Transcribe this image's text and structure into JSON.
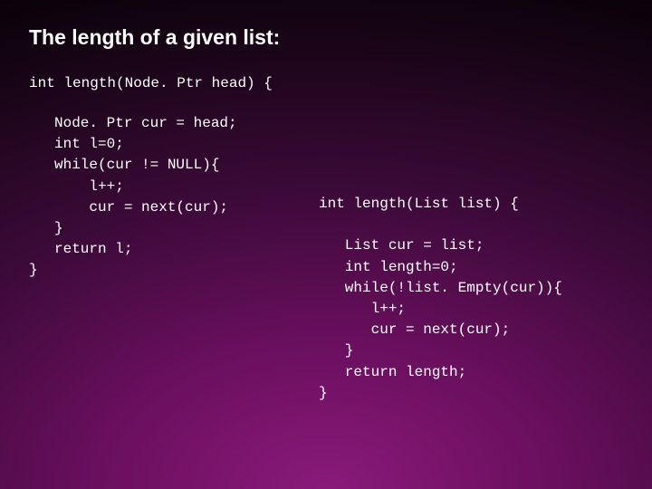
{
  "title": "The length of a given list:",
  "signature": "int length(Node. Ptr head) {",
  "code_left": "Node. Ptr cur = head;\nint l=0;\nwhile(cur != NULL){\n    l++;\n    cur = next(cur);\n}\nreturn l;",
  "code_left_close": "}",
  "code_right": "int length(List list) {\n\n   List cur = list;\n   int length=0;\n   while(!list. Empty(cur)){\n      l++;\n      cur = next(cur);\n   }\n   return length;\n}"
}
